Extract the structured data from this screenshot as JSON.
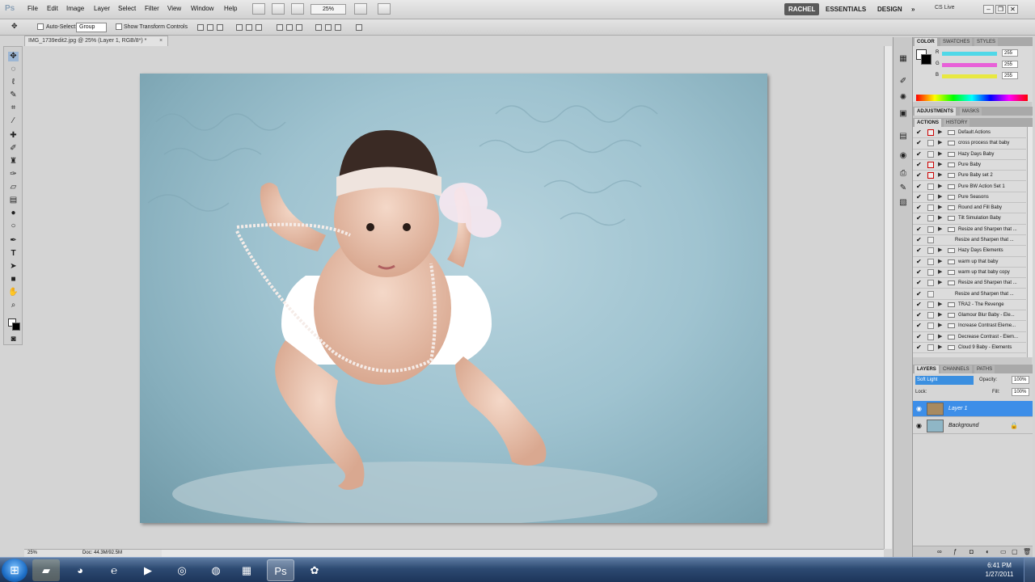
{
  "app": {
    "logo": "Ps"
  },
  "menu": [
    "File",
    "Edit",
    "Image",
    "Layer",
    "Select",
    "Filter",
    "View",
    "Window",
    "Help"
  ],
  "toolbar": {
    "zoom": "25%"
  },
  "workspaces": {
    "active": "RACHEL",
    "items": [
      "ESSENTIALS",
      "DESIGN"
    ],
    "more": "»"
  },
  "cslive": "CS Live",
  "window_controls": {
    "minimize": "–",
    "restore": "❐",
    "close": "✕"
  },
  "options": {
    "auto_select_label": "Auto-Select:",
    "group_value": "Group",
    "show_transform_label": "Show Transform Controls"
  },
  "document": {
    "tab_title": "IMG_1739edit2.jpg @ 25% (Layer 1, RGB/8*) *",
    "close": "×"
  },
  "status": {
    "zoom": "25%",
    "doc_size": "Doc: 44.3M/92.5M"
  },
  "color_panel": {
    "tabs": [
      "COLOR",
      "SWATCHES",
      "STYLES"
    ],
    "sliders": [
      {
        "label": "R",
        "value": "255",
        "color": "#4fd8e8"
      },
      {
        "label": "G",
        "value": "255",
        "color": "#e860d8"
      },
      {
        "label": "B",
        "value": "255",
        "color": "#e8e840"
      }
    ]
  },
  "adjust_tabs": [
    "ADJUSTMENTS",
    "MASKS"
  ],
  "actions_panel": {
    "tabs": [
      "ACTIONS",
      "HISTORY"
    ],
    "rows": [
      {
        "label": "Default Actions",
        "dialog": "red",
        "sub": false
      },
      {
        "label": "cross process that baby",
        "dialog": "plain",
        "sub": false
      },
      {
        "label": "Hazy Days Baby",
        "dialog": "plain",
        "sub": false
      },
      {
        "label": "Pure Baby",
        "dialog": "red",
        "sub": false
      },
      {
        "label": "Pure Baby set 2",
        "dialog": "red",
        "sub": false
      },
      {
        "label": "Pure BW Action Set 1",
        "dialog": "plain",
        "sub": false
      },
      {
        "label": "Pure Seasons",
        "dialog": "plain",
        "sub": false
      },
      {
        "label": "Round and Fill Baby",
        "dialog": "plain",
        "sub": false
      },
      {
        "label": "Tilt Simulation Baby",
        "dialog": "plain",
        "sub": false
      },
      {
        "label": "Resize and Sharpen that ...",
        "dialog": "plain",
        "sub": false
      },
      {
        "label": "Resize and Sharpen that ...",
        "dialog": "plain",
        "sub": true
      },
      {
        "label": "Hazy Days Elements",
        "dialog": "plain",
        "sub": false
      },
      {
        "label": "warm up that baby",
        "dialog": "plain",
        "sub": false
      },
      {
        "label": "warm up that baby copy",
        "dialog": "plain",
        "sub": false
      },
      {
        "label": "Resize and Sharpen that ...",
        "dialog": "plain",
        "sub": false
      },
      {
        "label": "Resize and Sharpen that ...",
        "dialog": "plain",
        "sub": true
      },
      {
        "label": "TRA2 - The Revenge",
        "dialog": "plain",
        "sub": false
      },
      {
        "label": "Glamour Blur Baby - Ele...",
        "dialog": "plain",
        "sub": false
      },
      {
        "label": "Increase Contrast Eleme...",
        "dialog": "plain",
        "sub": false
      },
      {
        "label": "Decrease Contrast - Elem...",
        "dialog": "plain",
        "sub": false
      },
      {
        "label": "Cloud 9 Baby - Elements",
        "dialog": "plain",
        "sub": false
      }
    ]
  },
  "layers_panel": {
    "tabs": [
      "LAYERS",
      "CHANNELS",
      "PATHS"
    ],
    "blend_mode": "Soft Light",
    "opacity_label": "Opacity:",
    "opacity": "100%",
    "lock_label": "Lock:",
    "fill_label": "Fill:",
    "fill": "100%",
    "layers": [
      {
        "name": "Layer 1",
        "selected": true
      },
      {
        "name": "Background",
        "selected": false
      }
    ]
  },
  "taskbar": {
    "time": "6:41 PM",
    "date": "1/27/2011"
  },
  "colors": {
    "selection": "#3d8ee8",
    "canvas_bg": "#d4d4d4",
    "photo_blue": "#9fc3d0"
  }
}
